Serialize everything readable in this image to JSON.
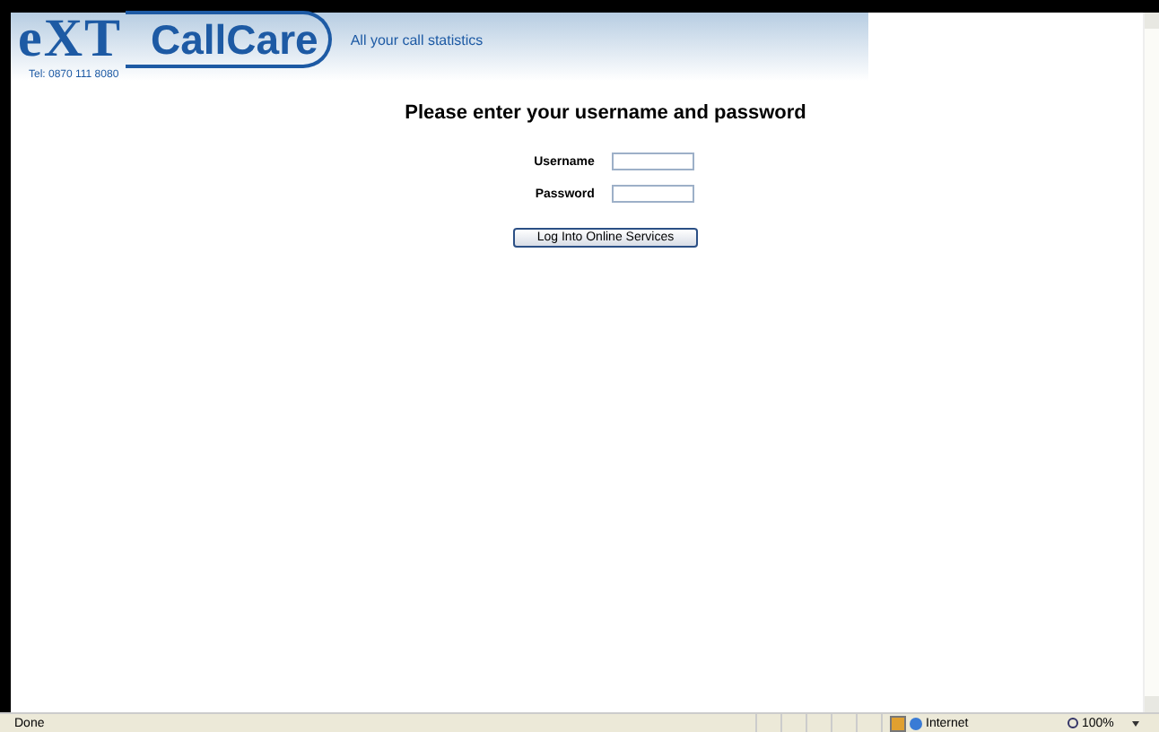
{
  "header": {
    "logo_mark": "eXT",
    "logo_name": "CallCare",
    "tagline": "All your call statistics",
    "phone": "Tel: 0870 111 8080"
  },
  "login": {
    "heading": "Please enter your username and password",
    "fields": [
      {
        "label": "Username"
      },
      {
        "label": "Password"
      }
    ],
    "button": "Log Into Online Services"
  },
  "status_bar": {
    "text": "Done",
    "zone": "Internet",
    "zoom": "100%"
  }
}
